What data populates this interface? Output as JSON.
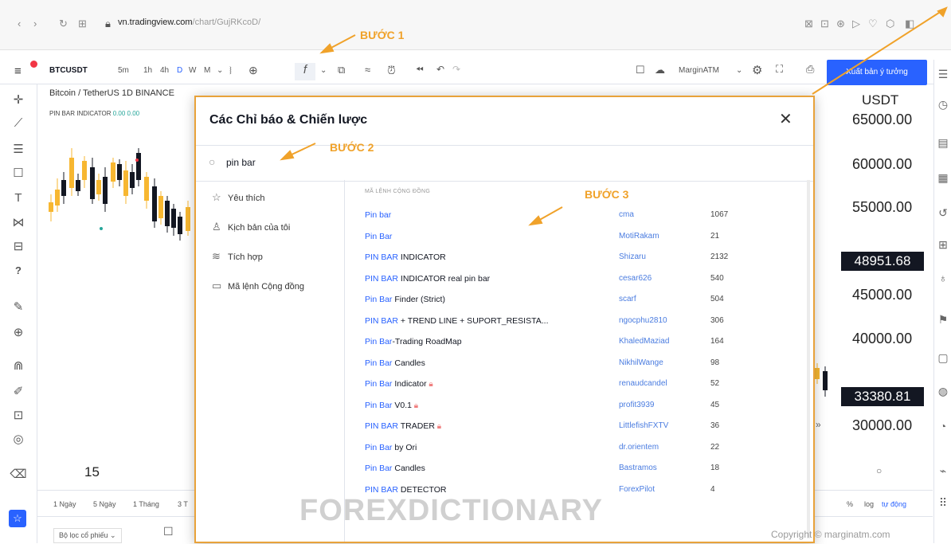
{
  "browser": {
    "url_host": "vn.tradingview.com",
    "url_path": "/chart/GujRKcoD/"
  },
  "toolbar": {
    "symbol": "BTCUSDT",
    "intervals": [
      "5m",
      "1h",
      "4h",
      "D",
      "W",
      "M"
    ],
    "active_interval": "D",
    "margin_label": "MarginATM",
    "publish_label": "Xuất bản ý tưởng"
  },
  "chart": {
    "title": "Bitcoin / TetherUS  1D  BINANCE",
    "indicator_name": "PIN BAR INDICATOR",
    "indicator_values": "0.00 0.00",
    "currency": "USDT",
    "price_levels": [
      "65000.00",
      "60000.00",
      "55000.00",
      "45000.00",
      "40000.00",
      "30000.00"
    ],
    "price_badges": [
      "48951.68",
      "33380.81"
    ],
    "day_label": "15",
    "ranges": [
      "1 Ngày",
      "5 Ngày",
      "1 Tháng",
      "3 T"
    ],
    "right_opts": [
      "%",
      "log",
      "tự động"
    ],
    "filter_label": "Bộ lọc cổ phiếu"
  },
  "dialog": {
    "title": "Các Chỉ báo & Chiến lược",
    "search_value": "pin bar",
    "nav": [
      {
        "icon": "star-icon",
        "glyph": "☆",
        "label": "Yêu thích"
      },
      {
        "icon": "user-icon",
        "glyph": "♙",
        "label": "Kịch bản của tôi"
      },
      {
        "icon": "wave-icon",
        "glyph": "≋",
        "label": "Tích hợp"
      },
      {
        "icon": "bookmark-icon",
        "glyph": "▭",
        "label": "Mã lệnh Cộng đồng"
      }
    ],
    "section_header": "MÃ LỆNH CỘNG ĐỒNG",
    "rows": [
      {
        "name_hl": "Pin bar",
        "name_rest": "",
        "locked": false,
        "author": "cma",
        "count": "1067"
      },
      {
        "name_hl": "Pin Bar",
        "name_rest": "",
        "locked": false,
        "author": "MotiRakam",
        "count": "21"
      },
      {
        "name_hl": "PIN BAR",
        "name_rest": " INDICATOR",
        "locked": false,
        "author": "Shizaru",
        "count": "2132"
      },
      {
        "name_hl": "PIN BAR",
        "name_rest": " INDICATOR real pin bar",
        "locked": false,
        "author": "cesar626",
        "count": "540"
      },
      {
        "name_hl": "Pin Bar",
        "name_rest": " Finder (Strict)",
        "locked": false,
        "author": "scarf",
        "count": "504"
      },
      {
        "name_hl": "PIN BAR",
        "name_rest": " + TREND LINE + SUPORT_RESISTA...",
        "locked": false,
        "author": "ngocphu2810",
        "count": "306"
      },
      {
        "name_hl": "Pin Bar",
        "name_rest": "-Trading RoadMap",
        "locked": false,
        "author": "KhaledMaziad",
        "count": "164"
      },
      {
        "name_hl": "Pin Bar",
        "name_rest": " Candles",
        "locked": false,
        "author": "NikhilWange",
        "count": "98"
      },
      {
        "name_hl": "Pin Bar",
        "name_rest": " Indicator",
        "locked": true,
        "author": "renaudcandel",
        "count": "52"
      },
      {
        "name_hl": "Pin Bar",
        "name_rest": " V0.1",
        "locked": true,
        "author": "profit3939",
        "count": "45"
      },
      {
        "name_hl": "PIN BAR",
        "name_rest": " TRADER",
        "locked": true,
        "author": "LittlefishFXTV",
        "count": "36"
      },
      {
        "name_hl": "Pin Bar",
        "name_rest": " by Ori",
        "locked": false,
        "author": "dr.orientem",
        "count": "22"
      },
      {
        "name_hl": "Pin Bar",
        "name_rest": " Candles",
        "locked": false,
        "author": "Bastramos",
        "count": "18"
      },
      {
        "name_hl": "PIN BAR",
        "name_rest": " DETECTOR",
        "locked": false,
        "author": "ForexPilot",
        "count": "4"
      }
    ]
  },
  "annotations": {
    "step1": "BƯỚC 1",
    "step2": "BƯỚC 2",
    "step3": "BƯỚC 3",
    "color": "#f0a22a"
  },
  "watermark": "FOREXDICTIONARY",
  "copyright": "Copyright © marginatm.com",
  "colors": {
    "accent": "#2962ff",
    "up_candle": "#f7b731",
    "down_candle": "#131722"
  }
}
